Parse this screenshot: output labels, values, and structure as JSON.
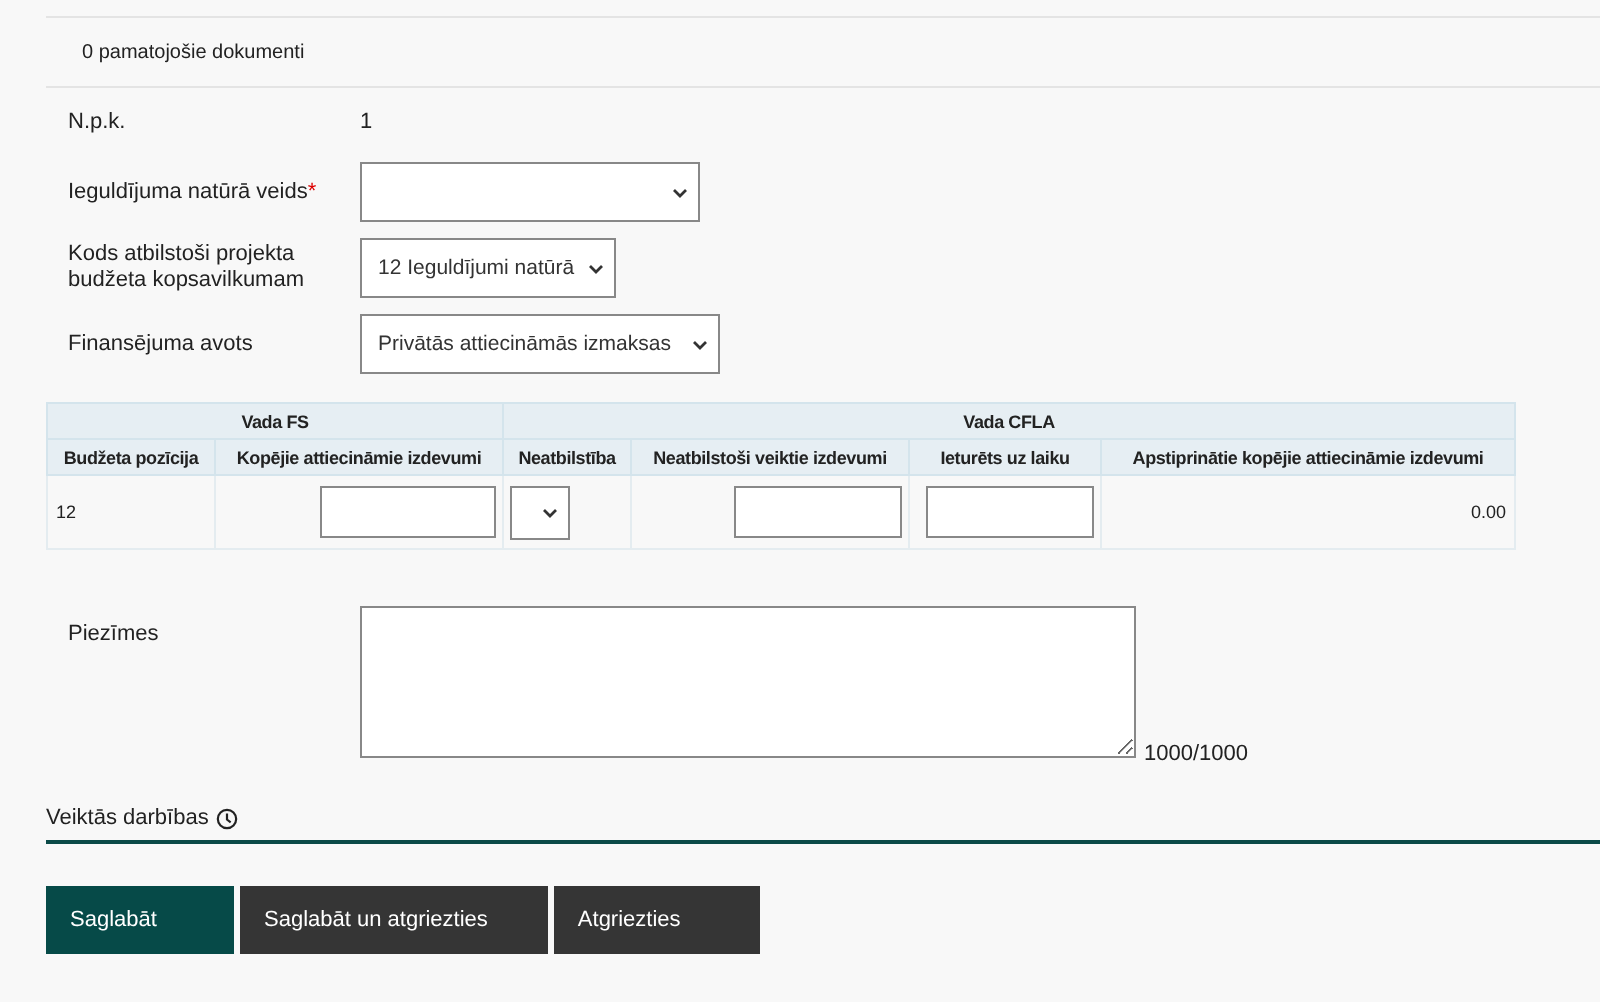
{
  "documents_link": "0 pamatojošie dokumenti",
  "form": [
    {
      "kind": "text",
      "label": "N.p.k.",
      "value": "1"
    },
    {
      "kind": "select",
      "label": "Ieguldījuma natūrā veids",
      "required_mark": "*"
    },
    {
      "kind": "select",
      "label": "Kods atbilstoši projekta budžeta kopsavilkumam",
      "value": "12 Ieguldījumi natūrā"
    },
    {
      "kind": "select",
      "label": "Finansējuma avots",
      "value": "Privātās attiecināmās izmaksas"
    }
  ],
  "table": {
    "groups": [
      "Vada FS",
      "Vada CFLA"
    ],
    "columns": [
      "Budžeta pozīcija",
      "Kopējie attiecināmie izdevumi",
      "Neatbilstība",
      "Neatbilstoši veiktie izdevumi",
      "Ieturēts uz laiku",
      "Apstiprinātie kopējie attiecināmie izdevumi"
    ],
    "rows": [
      [
        {
          "kind": "text",
          "value": "12"
        },
        {
          "kind": "input"
        },
        {
          "kind": "select"
        },
        {
          "kind": "input"
        },
        {
          "kind": "input"
        },
        {
          "kind": "number",
          "value": "0.00"
        }
      ]
    ]
  },
  "notes": {
    "label": "Piezīmes",
    "counter": "1000/1000"
  },
  "history": {
    "label": "Veiktās darbības"
  },
  "buttons": [
    {
      "label": "Saglabāt",
      "kind": "primary"
    },
    {
      "label": "Saglabāt un atgriezties",
      "kind": "secondary"
    },
    {
      "label": "Atgriezties",
      "kind": "secondary"
    }
  ]
}
